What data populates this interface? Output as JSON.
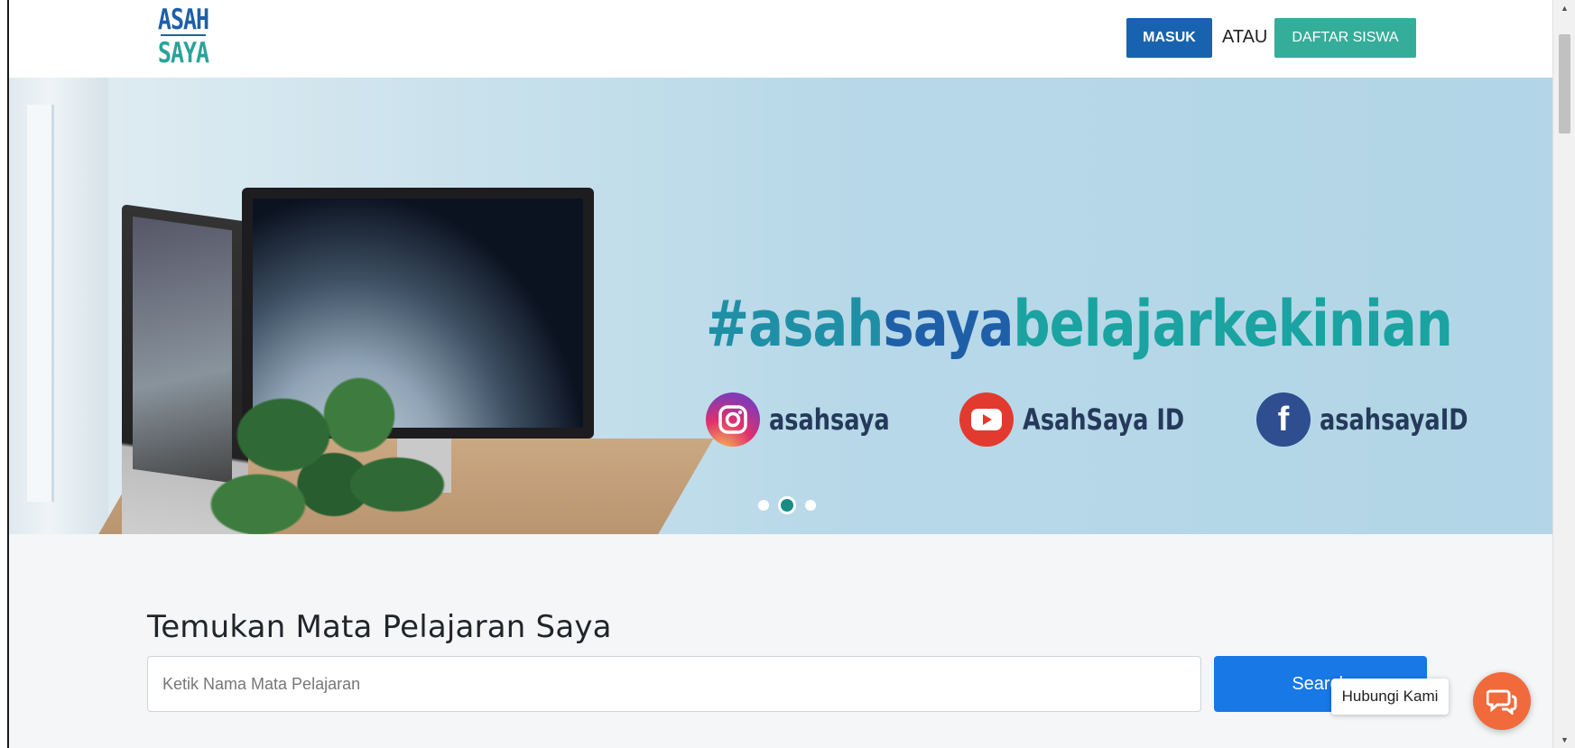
{
  "header": {
    "logo_line1": "ASAH",
    "logo_line2": "SAYA",
    "login_label": "MASUK",
    "or_label": "ATAU",
    "register_label": "DAFTAR SISWA"
  },
  "hero": {
    "hashtag_part1": "#asah",
    "hashtag_part2": "saya",
    "hashtag_part3": "belajarkekinian",
    "socials": [
      {
        "icon": "instagram-icon",
        "label": "asahsaya"
      },
      {
        "icon": "youtube-icon",
        "label": "AsahSaya ID"
      },
      {
        "icon": "facebook-icon",
        "label": "asahsayaID"
      }
    ],
    "carousel": {
      "slides": 3,
      "active_index": 2
    }
  },
  "search": {
    "title": "Temukan Mata Pelajaran Saya",
    "placeholder": "Ketik Nama Mata Pelajaran",
    "value": "",
    "button_label": "Search"
  },
  "chat": {
    "label": "Hubungi Kami",
    "icon": "chat-bubbles-icon"
  },
  "colors": {
    "primary_blue": "#1863b0",
    "teal": "#35ad9b",
    "search_blue": "#1778e6",
    "chat_orange": "#f06a3c"
  }
}
